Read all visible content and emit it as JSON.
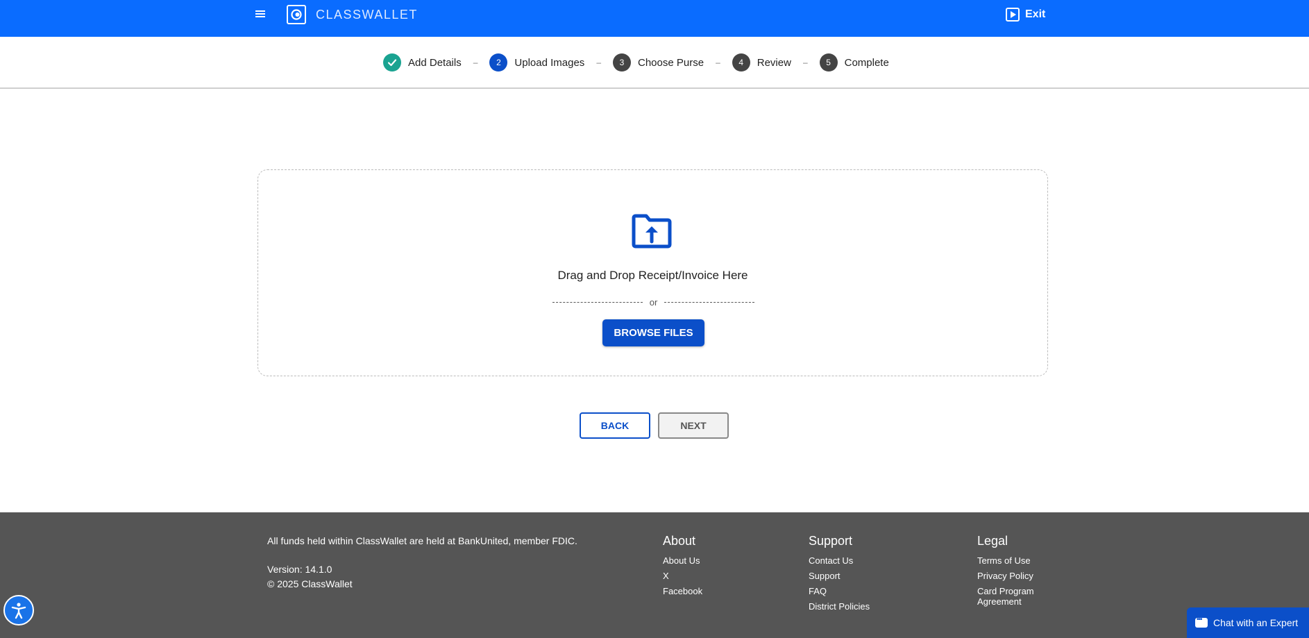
{
  "header": {
    "brand": "CLASSWALLET",
    "exit_label": "Exit"
  },
  "stepper": [
    {
      "num": "",
      "label": "Add Details",
      "status": "done"
    },
    {
      "num": "2",
      "label": "Upload Images",
      "status": "active"
    },
    {
      "num": "3",
      "label": "Choose Purse",
      "status": "pending"
    },
    {
      "num": "4",
      "label": "Review",
      "status": "pending"
    },
    {
      "num": "5",
      "label": "Complete",
      "status": "pending"
    }
  ],
  "upload": {
    "icon": "folder-upload-icon",
    "prompt": "Drag and Drop Receipt/Invoice Here",
    "or_label": "or",
    "browse_label": "BROWSE FILES"
  },
  "nav": {
    "back_label": "BACK",
    "next_label": "NEXT"
  },
  "footer": {
    "disclaimer": "All funds held within ClassWallet are held at BankUnited, member FDIC.",
    "version": "Version: 14.1.0",
    "copyright": "© 2025 ClassWallet",
    "about": {
      "title": "About",
      "links": [
        "About Us",
        "X",
        "Facebook"
      ]
    },
    "support": {
      "title": "Support",
      "links": [
        "Contact Us",
        "Support",
        "FAQ",
        "District Policies"
      ]
    },
    "legal": {
      "title": "Legal",
      "links": [
        "Terms of Use",
        "Privacy Policy",
        "Card Program Agreement"
      ]
    }
  },
  "chat": {
    "label": "Chat with an Expert"
  },
  "colors": {
    "header_bg": "#0a6cff",
    "primary": "#0b4fc9",
    "done": "#1aa391",
    "footer_bg": "#555555"
  }
}
